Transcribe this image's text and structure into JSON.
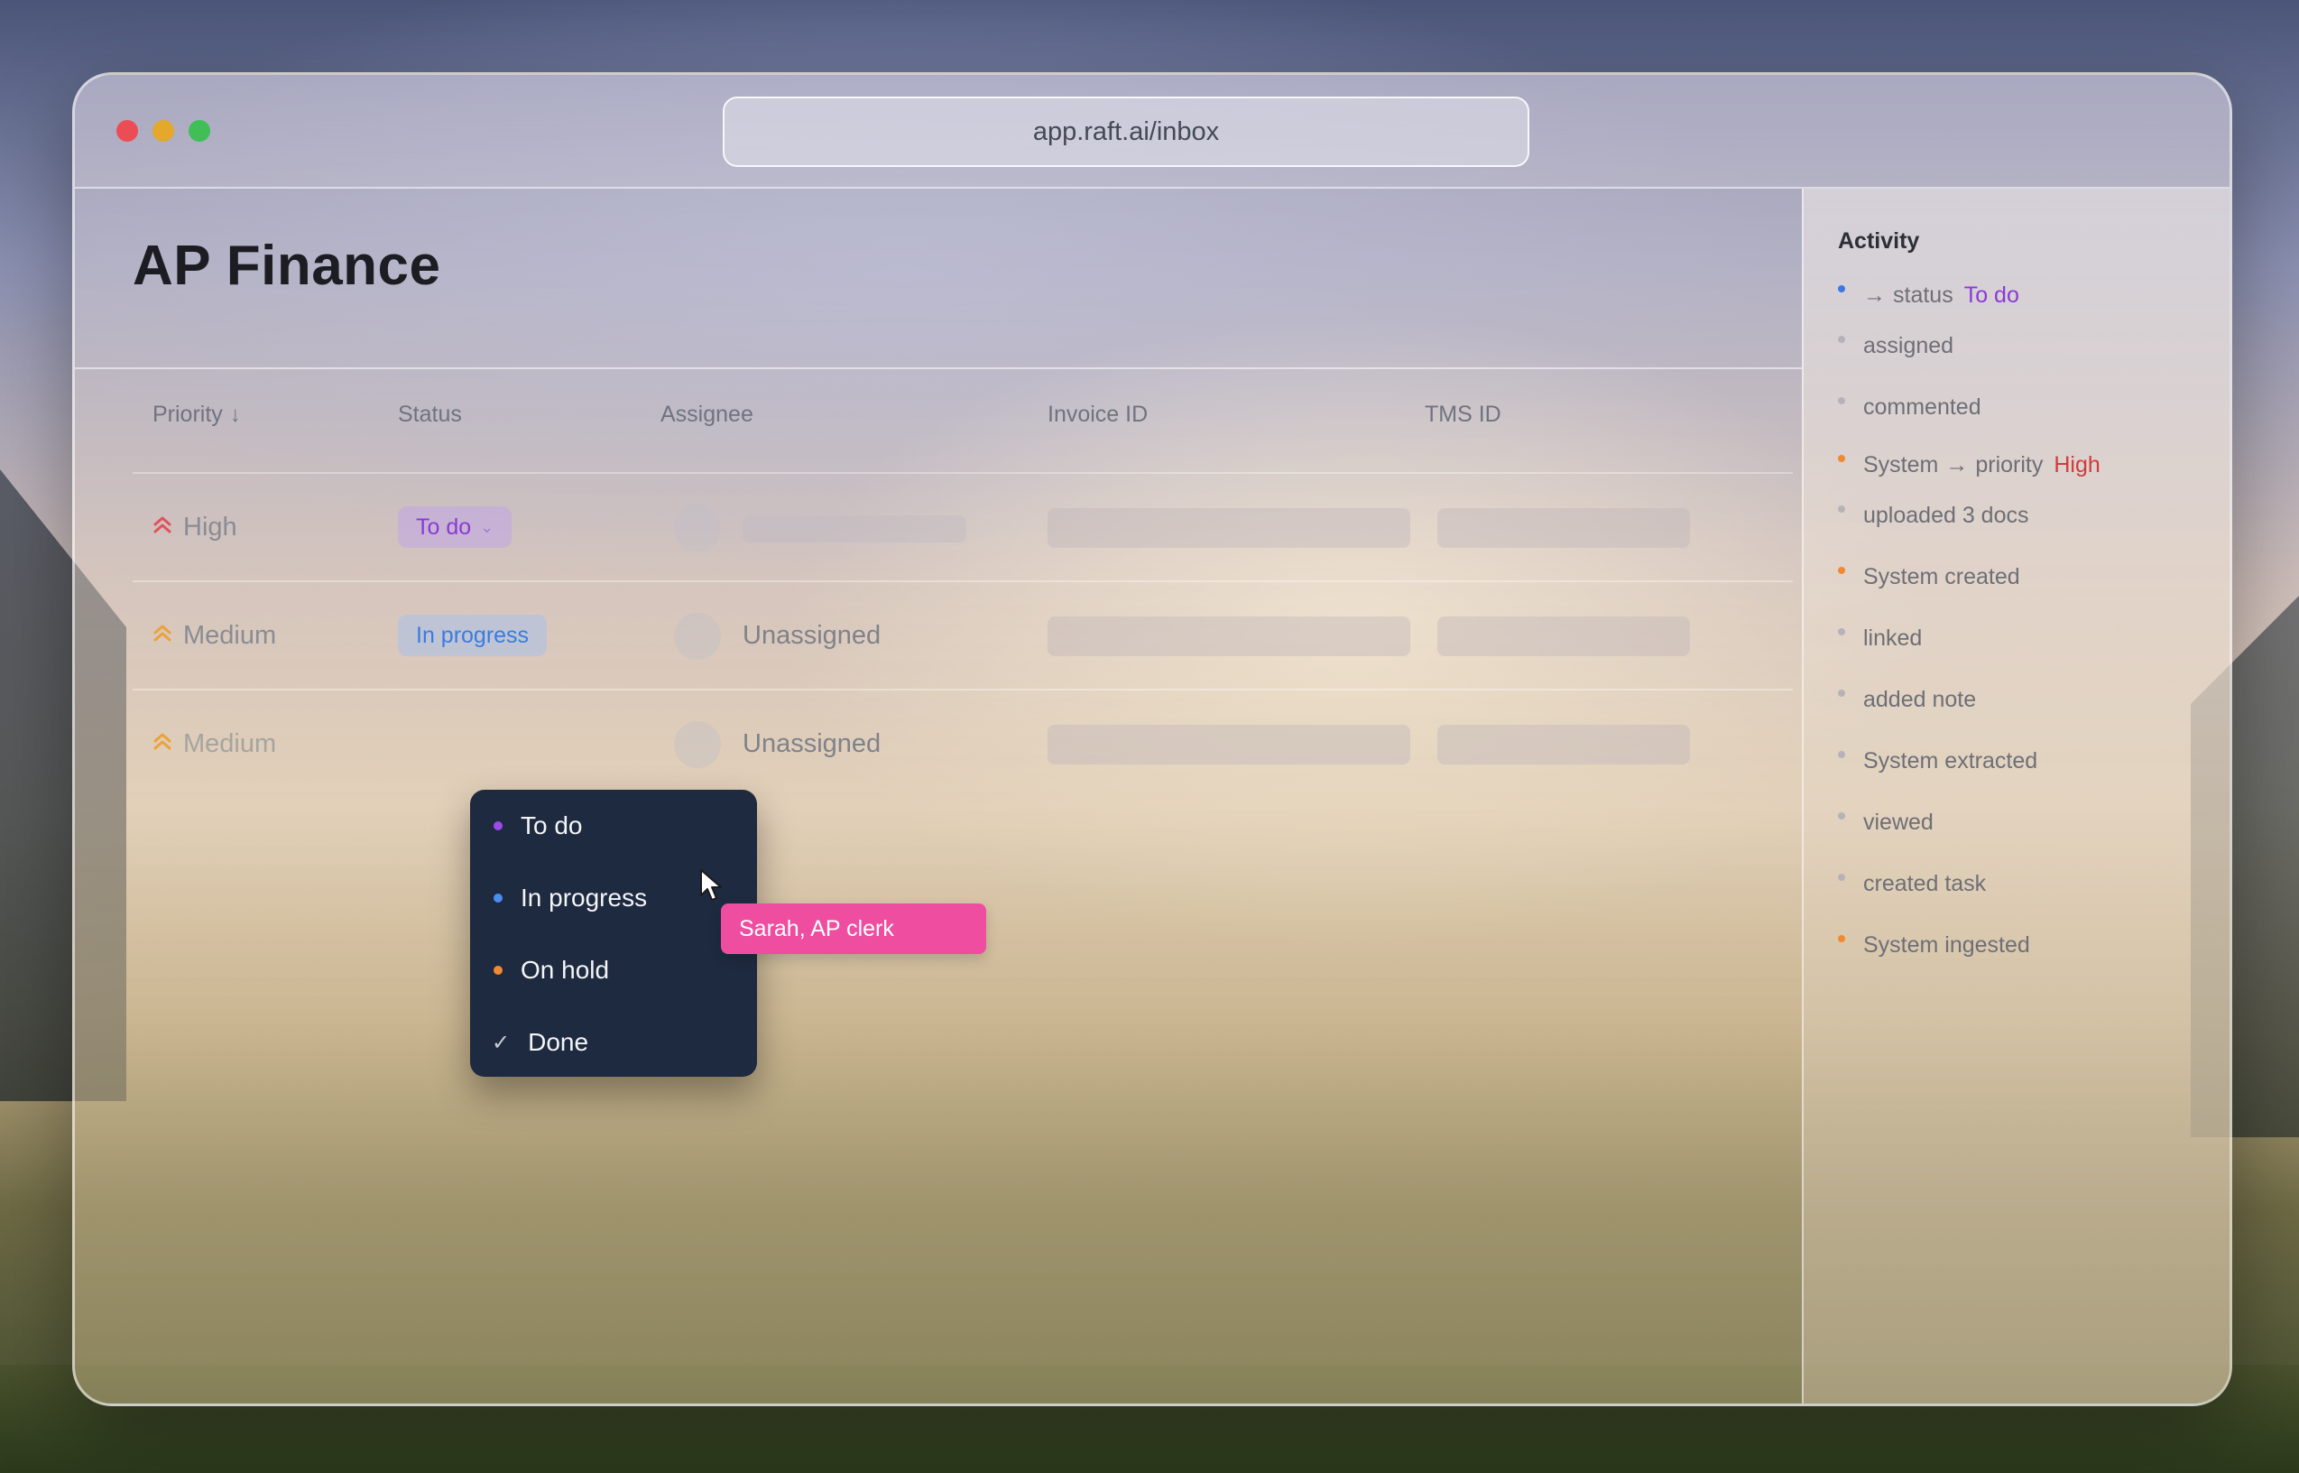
{
  "browser": {
    "url": "app.raft.ai/inbox"
  },
  "page": {
    "title": "AP Finance"
  },
  "table": {
    "headers": {
      "priority": "Priority",
      "status": "Status",
      "assignee": "Assignee",
      "invoice_id": "Invoice ID",
      "tms_id": "TMS ID"
    },
    "rows": [
      {
        "priority": "High",
        "status": "To do",
        "assignee": ""
      },
      {
        "priority": "Medium",
        "status": "In progress",
        "assignee": "Unassigned"
      },
      {
        "priority": "Medium",
        "status": "",
        "assignee": "Unassigned"
      }
    ]
  },
  "status_menu": {
    "options": [
      "To do",
      "In progress",
      "On hold",
      "Done"
    ],
    "selected": "Done"
  },
  "collaborator": {
    "label": "Sarah, AP clerk",
    "color": "#ef4da0"
  },
  "activity": {
    "title": "Activity",
    "items": [
      {
        "arrow": "→",
        "text": "status",
        "highlight": "To do"
      },
      {
        "text": "assigned"
      },
      {
        "text": "commented"
      },
      {
        "actor": "System",
        "arrow": "→",
        "text": "priority",
        "highlight": "High"
      },
      {
        "text": "uploaded 3 docs"
      },
      {
        "text": "System created"
      },
      {
        "text": "linked"
      },
      {
        "text": "added note"
      },
      {
        "text": "System extracted"
      },
      {
        "text": "viewed"
      },
      {
        "text": "created task"
      },
      {
        "text": "System ingested"
      }
    ]
  },
  "colors": {
    "todo": "#8a3ad6",
    "in_progress": "#3a7be0",
    "on_hold": "#f08a32",
    "high": "#e0525a",
    "medium": "#eba23a"
  }
}
